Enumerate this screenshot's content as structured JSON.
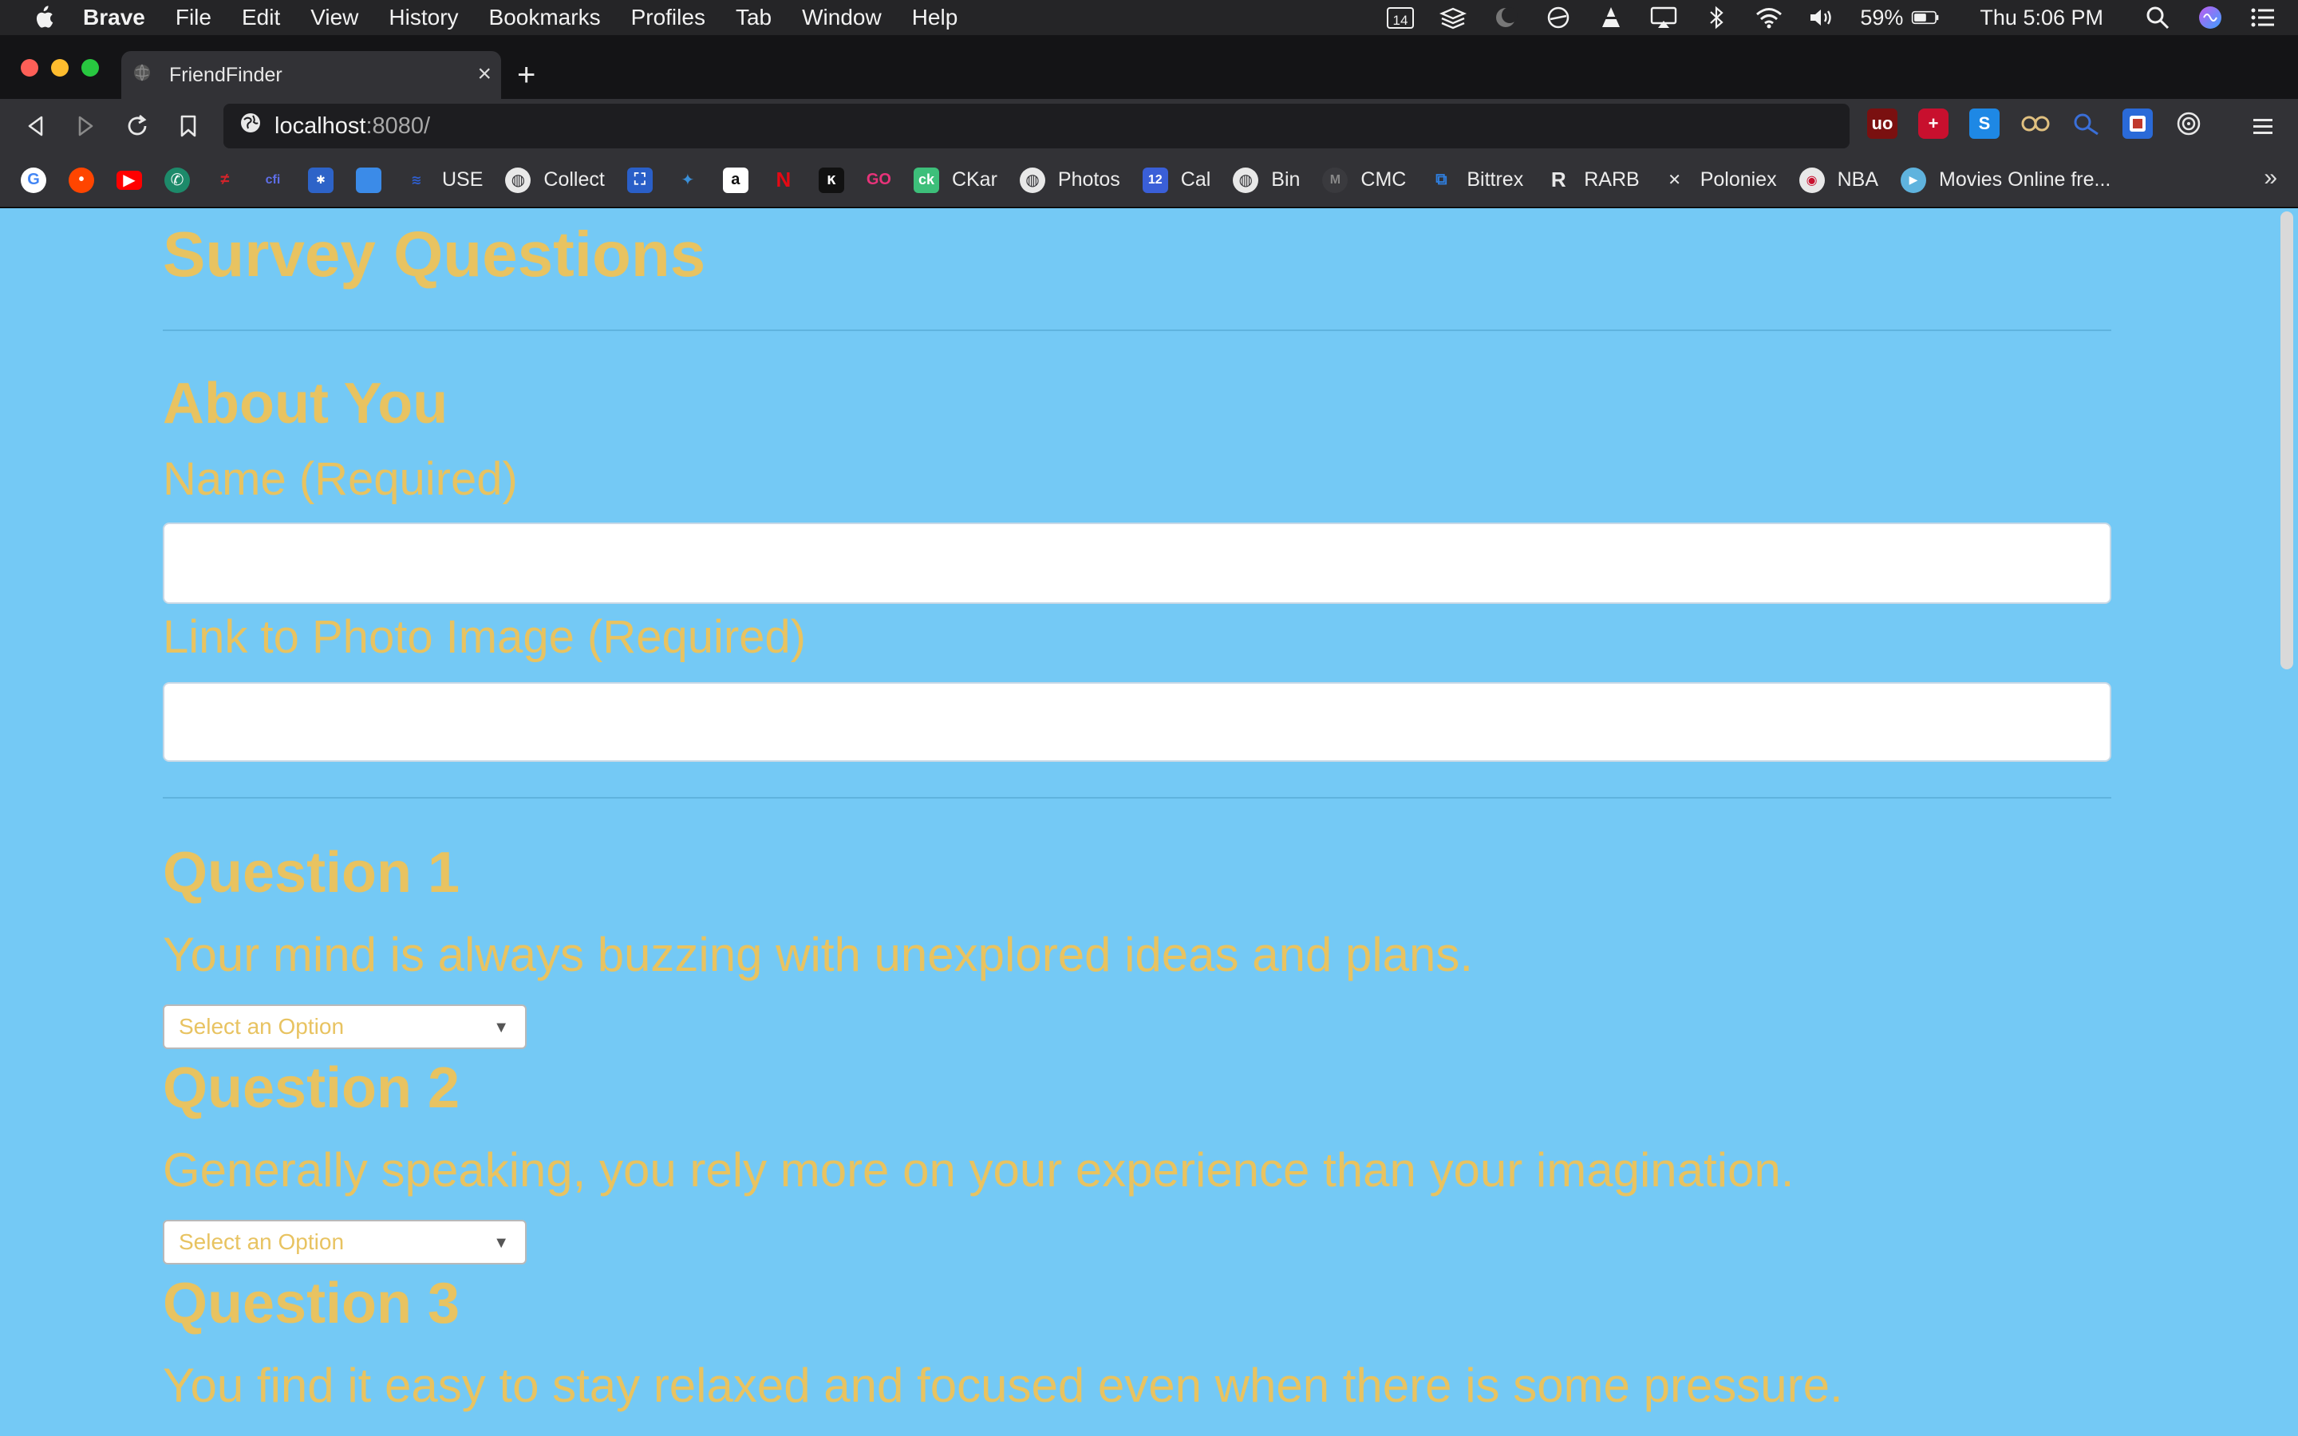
{
  "menubar": {
    "app_name": "Brave",
    "items": [
      "File",
      "Edit",
      "View",
      "History",
      "Bookmarks",
      "Profiles",
      "Tab",
      "Window",
      "Help"
    ],
    "calendar_day": "14",
    "battery": "59%",
    "clock": "Thu 5:06 PM"
  },
  "tab": {
    "title": "FriendFinder",
    "close": "×",
    "new_tab": "+"
  },
  "toolbar": {
    "url_host": "localhost",
    "url_rest": ":8080/"
  },
  "bookmarks": {
    "items": [
      {
        "icon": "google-icon",
        "label": ""
      },
      {
        "icon": "reddit-icon",
        "label": ""
      },
      {
        "icon": "youtube-icon",
        "label": ""
      },
      {
        "icon": "phone-icon",
        "label": ""
      },
      {
        "icon": "airline-icon",
        "label": ""
      },
      {
        "icon": "bank-icon",
        "label": ""
      },
      {
        "icon": "bank2-icon",
        "label": ""
      },
      {
        "icon": "square-icon",
        "label": ""
      },
      {
        "icon": "use-icon",
        "label": "USE"
      },
      {
        "icon": "globe-icon",
        "label": "Collect"
      },
      {
        "icon": "scan-icon",
        "label": ""
      },
      {
        "icon": "bird-icon",
        "label": ""
      },
      {
        "icon": "amazon-icon",
        "label": "a"
      },
      {
        "icon": "netflix-icon",
        "label": "N"
      },
      {
        "icon": "k-icon",
        "label": ""
      },
      {
        "icon": "go-icon",
        "label": "GO"
      },
      {
        "icon": "ck-icon",
        "label": "CKar"
      },
      {
        "icon": "globe-icon",
        "label": "Photos"
      },
      {
        "icon": "calendar-icon",
        "label": "Cal"
      },
      {
        "icon": "globe-icon",
        "label": "Bin"
      },
      {
        "icon": "cmc-icon",
        "label": "CMC"
      },
      {
        "icon": "bittrex-icon",
        "label": "Bittrex"
      },
      {
        "icon": "rarb-icon",
        "label": "RARB"
      },
      {
        "icon": "poloniex-icon",
        "label": "Poloniex"
      },
      {
        "icon": "nba-icon",
        "label": "NBA"
      },
      {
        "icon": "play-icon",
        "label": "Movies Online fre..."
      }
    ],
    "more": "»"
  },
  "page": {
    "title": "Survey Questions",
    "about_heading": "About You",
    "name_label": "Name (Required)",
    "name_value": "",
    "photo_label": "Link to Photo Image (Required)",
    "photo_value": "",
    "questions": [
      {
        "heading": "Question 1",
        "text": "Your mind is always buzzing with unexplored ideas and plans.",
        "selected": "Select an Option"
      },
      {
        "heading": "Question 2",
        "text": "Generally speaking, you rely more on your experience than your imagination.",
        "selected": "Select an Option"
      },
      {
        "heading": "Question 3",
        "text": "You find it easy to stay relaxed and focused even when there is some pressure."
      }
    ]
  },
  "colors": {
    "page_bg": "#74c9f5",
    "text_accent": "#e8c361",
    "chrome_dark": "#323236"
  }
}
